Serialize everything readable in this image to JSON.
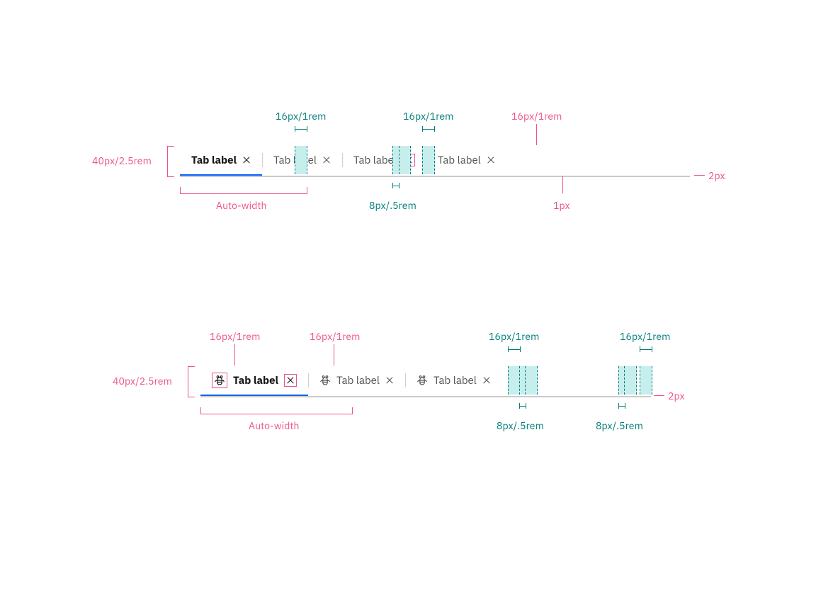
{
  "annotations": {
    "height": "40px/2.5rem",
    "autoWidth": "Auto-width",
    "p16": "16px/1rem",
    "p8": "8px/.5rem",
    "d1": "1px",
    "d2": "2px"
  },
  "tabs": {
    "label": "Tab label"
  }
}
